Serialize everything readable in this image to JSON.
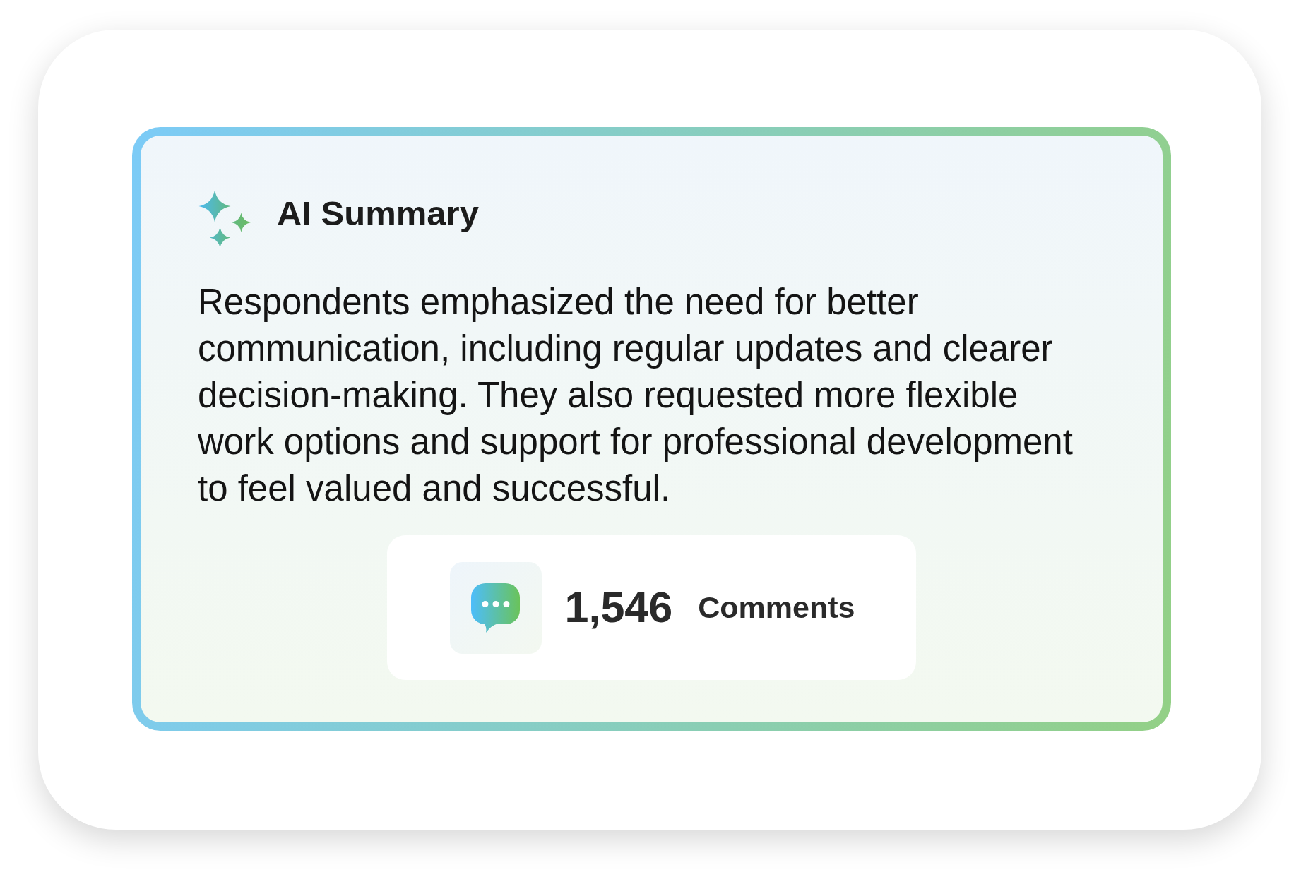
{
  "summary_card": {
    "title": "AI Summary",
    "summary": "Respondents emphasized the need for better communication, including regular updates and clearer decision-making. They also requested more flexible work options and support for professional development to feel valued and successful.",
    "comments_stat": {
      "value": "1,546",
      "label": "Comments"
    }
  }
}
